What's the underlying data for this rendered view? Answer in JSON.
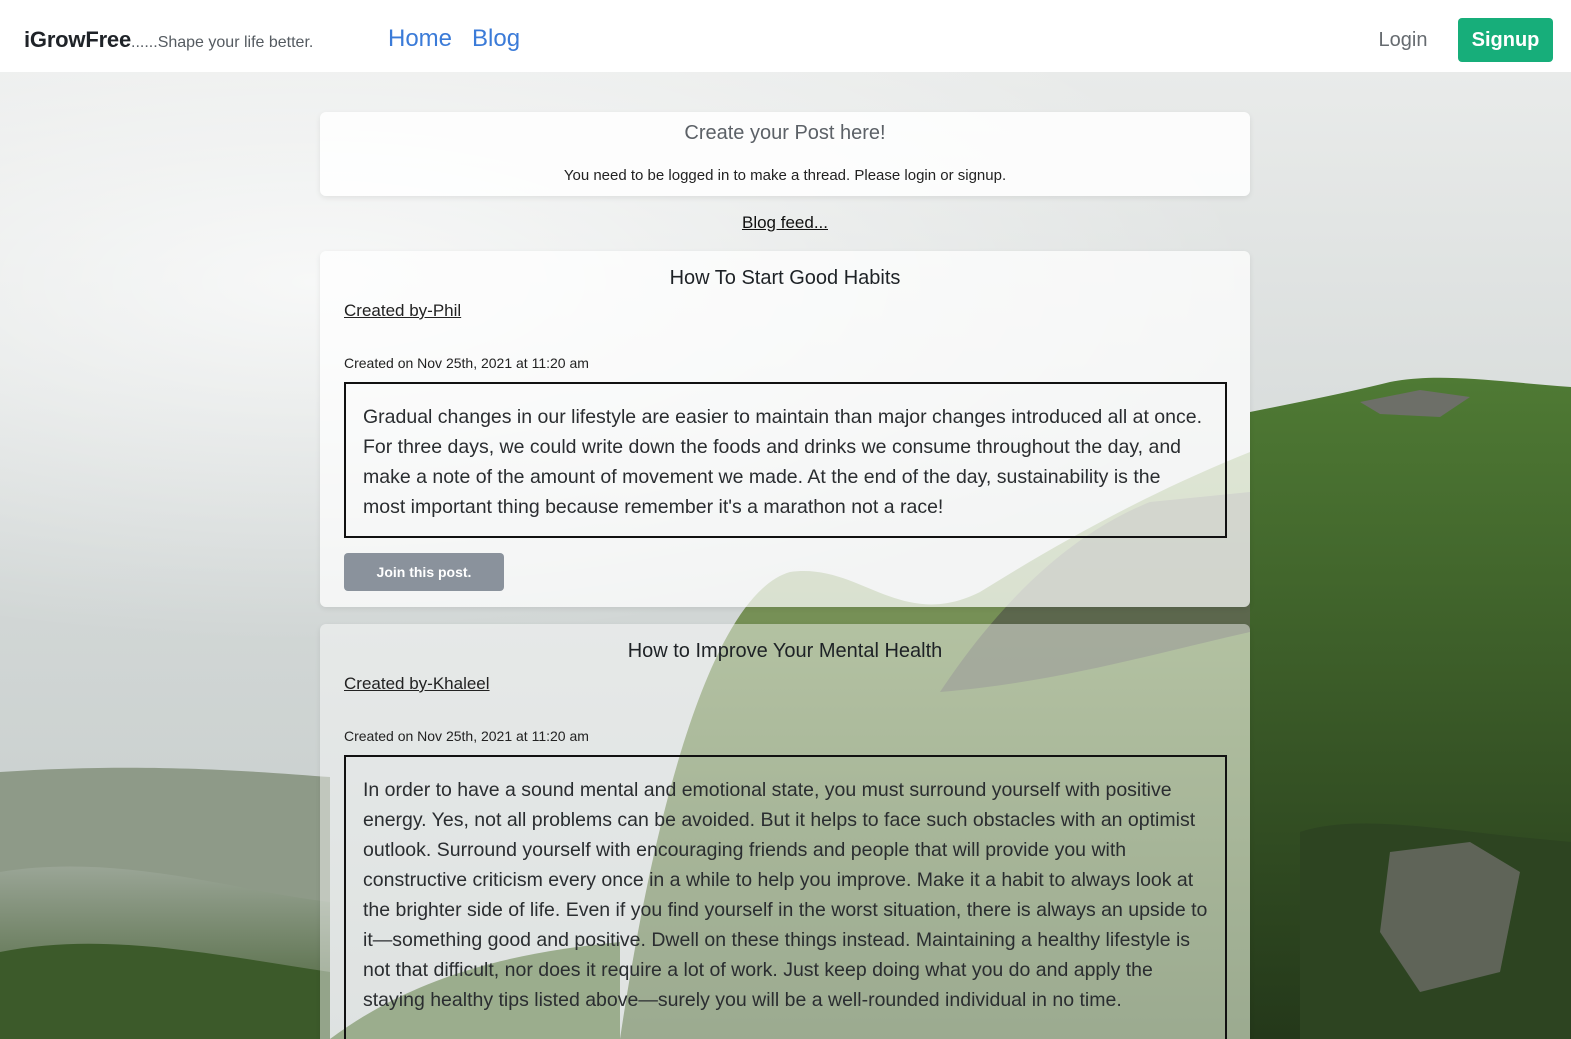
{
  "navbar": {
    "brand": "iGrowFree",
    "tagline": "......Shape your life better.",
    "links": [
      "Home",
      "Blog"
    ],
    "login_label": "Login",
    "signup_label": "Signup",
    "accent_color": "#3b7bd8",
    "signup_color": "#17ae7a"
  },
  "create": {
    "title": "Create your Post here!",
    "note": "You need to be logged in to make a thread. Please login or signup."
  },
  "feed": {
    "title": "Blog feed..."
  },
  "posts": [
    {
      "title": "How To Start Good Habits",
      "author": "Created by-Phil",
      "date": "Created on Nov 25th, 2021 at 11:20 am",
      "body": "Gradual changes in our lifestyle are easier to maintain than major changes introduced all at once. For three days, we could write down the foods and drinks we consume throughout the day, and make a note of the amount of movement we made. At the end of the day, sustainability is the most important thing because remember it's a marathon not a race!",
      "join_label": "Join this post."
    },
    {
      "title": "How to Improve Your Mental Health",
      "author": "Created by-Khaleel",
      "date": "Created on Nov 25th, 2021 at 11:20 am",
      "body": "In order to have a sound mental and emotional state, you must surround yourself with positive energy. Yes, not all problems can be avoided. But it helps to face such obstacles with an optimist outlook. Surround yourself with encouraging friends and people that will provide you with constructive criticism every once in a while to help you improve. Make it a habit to always look at the brighter side of life. Even if you find yourself in the worst situation, there is always an upside to it—something good and positive. Dwell on these things instead. Maintaining a healthy lifestyle is not that difficult, nor does it require a lot of work. Just keep doing what you do and apply the staying healthy tips listed above—surely you will be a well-rounded individual in no time."
    }
  ]
}
